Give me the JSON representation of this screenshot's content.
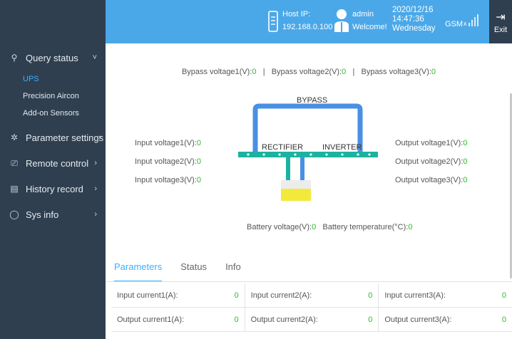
{
  "header": {
    "host_label": "Host IP:",
    "host_ip": "192.168.0.100",
    "user": "admin",
    "welcome": "Welcome!",
    "date": "2020/12/16",
    "time": "14:47:36",
    "weekday": "Wednesday",
    "signal": "GSM",
    "exit_label": "Exit"
  },
  "sidebar": {
    "items": [
      {
        "label": "Query status",
        "icon": "search-icon",
        "arrow": "˅"
      },
      {
        "label": "Parameter settings",
        "icon": "gear-icon",
        "arrow": "›"
      },
      {
        "label": "Remote control",
        "icon": "monitor-icon",
        "arrow": "›"
      },
      {
        "label": "History record",
        "icon": "clipboard-icon",
        "arrow": "›"
      },
      {
        "label": "Sys info",
        "icon": "info-icon",
        "arrow": "›"
      }
    ],
    "sub_items": [
      "UPS",
      "Precision Aircon",
      "Add-on Sensors"
    ]
  },
  "diagram": {
    "bypass_v1_label": "Bypass voltage1(V):",
    "bypass_v1": "0",
    "bypass_v2_label": "Bypass voltage2(V):",
    "bypass_v2": "0",
    "bypass_v3_label": "Bypass voltage3(V):",
    "bypass_v3": "0",
    "sep": "|",
    "bypass": "BYPASS",
    "rectifier": "RECTIFIER",
    "inverter": "INVERTER",
    "in1_label": "Input voltage1(V):",
    "in1": "0",
    "in2_label": "Input voltage2(V):",
    "in2": "0",
    "in3_label": "Input voltage3(V):",
    "in3": "0",
    "out1_label": "Output voltage1(V):",
    "out1": "0",
    "out2_label": "Output voltage2(V):",
    "out2": "0",
    "out3_label": "Output voltage3(V):",
    "out3": "0",
    "bat_v_label": "Battery voltage(V):",
    "bat_v": "0",
    "bat_t_label": "Battery temperature(°C):",
    "bat_t": "0"
  },
  "tabs": [
    "Parameters",
    "Status",
    "Info"
  ],
  "table": [
    [
      {
        "label": "Input current1(A):",
        "value": "0"
      },
      {
        "label": "Input current2(A):",
        "value": "0"
      },
      {
        "label": "Input current3(A):",
        "value": "0"
      }
    ],
    [
      {
        "label": "Output current1(A):",
        "value": "0"
      },
      {
        "label": "Output current2(A):",
        "value": "0"
      },
      {
        "label": "Output current3(A):",
        "value": "0"
      }
    ]
  ],
  "colors": {
    "accent": "#3ab0ff",
    "value": "#2eb82e",
    "sidebar": "#2f3f50",
    "topbar": "#4ba8e8",
    "pipe": "#4a90e2",
    "battery": "#f2e93b"
  }
}
